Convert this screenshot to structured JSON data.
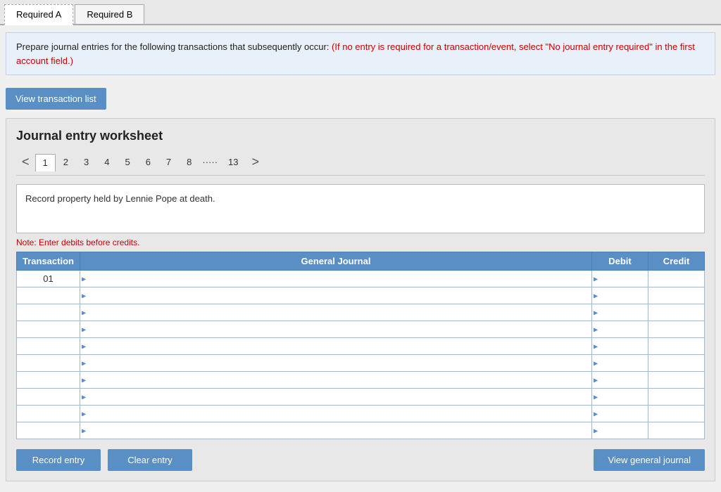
{
  "tabs": [
    {
      "label": "Required A",
      "active": true,
      "dashed": true
    },
    {
      "label": "Required B",
      "active": false,
      "dashed": false
    }
  ],
  "instructions": {
    "main_text": "Prepare journal entries for the following transactions that subsequently occur:",
    "highlight_text": "(If no entry is required for a transaction/event, select \"No journal entry required\" in the first account field.)"
  },
  "view_transaction_btn": "View transaction list",
  "worksheet": {
    "title": "Journal entry worksheet",
    "pages": [
      "1",
      "2",
      "3",
      "4",
      "5",
      "6",
      "7",
      "8",
      "…..",
      "13"
    ],
    "active_page": "1",
    "description": "Record property held by Lennie Pope at death.",
    "note": "Note: Enter debits before credits.",
    "table": {
      "headers": [
        "Transaction",
        "General Journal",
        "Debit",
        "Credit"
      ],
      "rows": [
        {
          "transaction": "01",
          "journal": "",
          "debit": "",
          "credit": ""
        },
        {
          "transaction": "",
          "journal": "",
          "debit": "",
          "credit": ""
        },
        {
          "transaction": "",
          "journal": "",
          "debit": "",
          "credit": ""
        },
        {
          "transaction": "",
          "journal": "",
          "debit": "",
          "credit": ""
        },
        {
          "transaction": "",
          "journal": "",
          "debit": "",
          "credit": ""
        },
        {
          "transaction": "",
          "journal": "",
          "debit": "",
          "credit": ""
        },
        {
          "transaction": "",
          "journal": "",
          "debit": "",
          "credit": ""
        },
        {
          "transaction": "",
          "journal": "",
          "debit": "",
          "credit": ""
        },
        {
          "transaction": "",
          "journal": "",
          "debit": "",
          "credit": ""
        },
        {
          "transaction": "",
          "journal": "",
          "debit": "",
          "credit": ""
        }
      ]
    },
    "buttons": {
      "record": "Record entry",
      "clear": "Clear entry",
      "view_journal": "View general journal"
    }
  }
}
